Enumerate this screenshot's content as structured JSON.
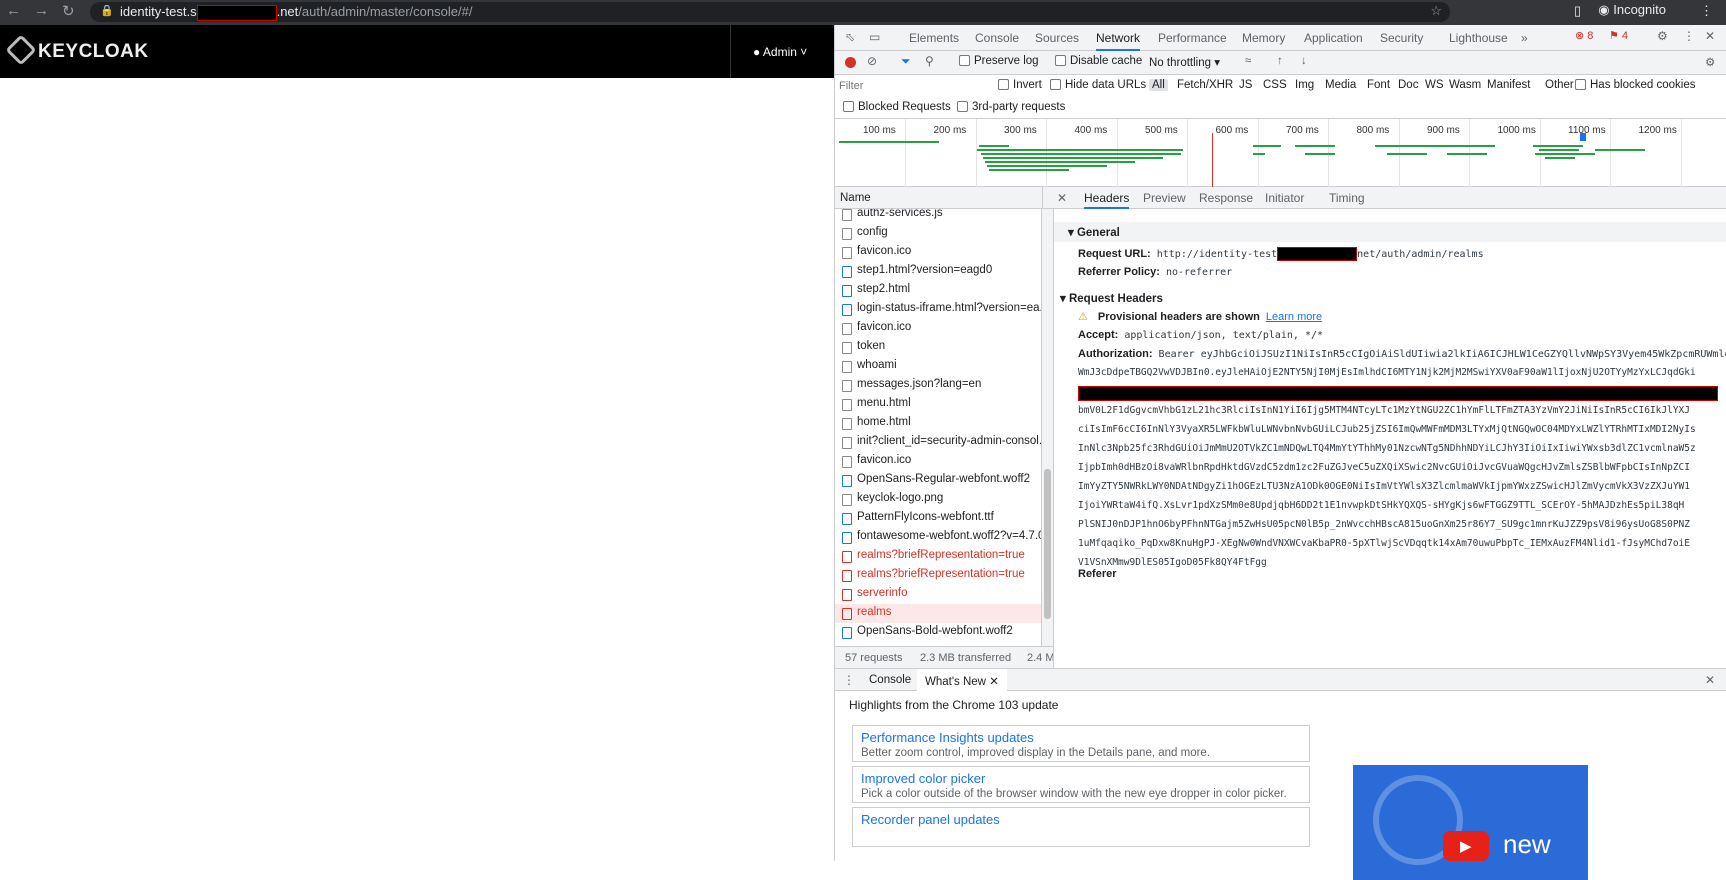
{
  "browser": {
    "url_host_prefix": "identity-test.s",
    "url_host_suffix": ".net",
    "url_path": "/auth/admin/master/console/#/",
    "profile": "Incognito"
  },
  "app": {
    "logo_text": "KEYCLOAK",
    "user_menu": "Admin"
  },
  "devtools": {
    "tabs": [
      "Elements",
      "Console",
      "Sources",
      "Network",
      "Performance",
      "Memory",
      "Application",
      "Security",
      "Lighthouse"
    ],
    "errors": "8",
    "warnings": "4",
    "toolbar": {
      "preserve_log": "Preserve log",
      "disable_cache": "Disable cache",
      "throttling": "No throttling"
    },
    "filter": {
      "placeholder": "Filter",
      "invert": "Invert",
      "hide_data_urls": "Hide data URLs",
      "types": [
        "All",
        "Fetch/XHR",
        "JS",
        "CSS",
        "Img",
        "Media",
        "Font",
        "Doc",
        "WS",
        "Wasm",
        "Manifest",
        "Other"
      ],
      "has_blocked_cookies": "Has blocked cookies",
      "blocked_requests": "Blocked Requests",
      "third_party": "3rd-party requests"
    },
    "timeline_ticks": [
      "100 ms",
      "200 ms",
      "300 ms",
      "400 ms",
      "500 ms",
      "600 ms",
      "700 ms",
      "800 ms",
      "900 ms",
      "1000 ms",
      "1100 ms",
      "1200 ms"
    ],
    "name_header": "Name",
    "requests": [
      {
        "name": "authz-services.js",
        "status": "ok"
      },
      {
        "name": "config",
        "status": "ok"
      },
      {
        "name": "favicon.ico",
        "status": "ok"
      },
      {
        "name": "step1.html?version=eagd0",
        "status": "doc"
      },
      {
        "name": "step2.html",
        "status": "doc"
      },
      {
        "name": "login-status-iframe.html?version=ea...",
        "status": "doc"
      },
      {
        "name": "favicon.ico",
        "status": "ok"
      },
      {
        "name": "token",
        "status": "ok"
      },
      {
        "name": "whoami",
        "status": "ok"
      },
      {
        "name": "messages.json?lang=en",
        "status": "ok"
      },
      {
        "name": "menu.html",
        "status": "ok"
      },
      {
        "name": "home.html",
        "status": "ok"
      },
      {
        "name": "init?client_id=security-admin-consol...",
        "status": "ok"
      },
      {
        "name": "favicon.ico",
        "status": "ok"
      },
      {
        "name": "OpenSans-Regular-webfont.woff2",
        "status": "font"
      },
      {
        "name": "keyclok-logo.png",
        "status": "img"
      },
      {
        "name": "PatternFlyIcons-webfont.ttf",
        "status": "font"
      },
      {
        "name": "fontawesome-webfont.woff2?v=4.7.0",
        "status": "font"
      },
      {
        "name": "realms?briefRepresentation=true",
        "status": "err"
      },
      {
        "name": "realms?briefRepresentation=true",
        "status": "err"
      },
      {
        "name": "serverinfo",
        "status": "err"
      },
      {
        "name": "realms",
        "status": "sel"
      },
      {
        "name": "OpenSans-Bold-webfont.woff2",
        "status": "font"
      }
    ],
    "summary": {
      "requests": "57 requests",
      "transferred": "2.3 MB transferred",
      "resources": "2.4 M"
    },
    "detail_tabs": [
      "Headers",
      "Preview",
      "Response",
      "Initiator",
      "Timing"
    ],
    "general": {
      "title": "General",
      "request_url_label": "Request URL:",
      "request_url_prefix": "http://identity-test",
      "request_url_suffix": "net/auth/admin/realms",
      "referrer_policy_label": "Referrer Policy:",
      "referrer_policy": "no-referrer"
    },
    "request_headers": {
      "title": "Request Headers",
      "provisional": "Provisional headers are shown",
      "learn_more": "Learn more",
      "accept_label": "Accept:",
      "accept": "application/json, text/plain, */*",
      "auth_label": "Authorization:",
      "auth_first": "Bearer eyJhbGciOiJSUzI1NiIsInR5cCIgOiAiSldUIiwia2lkIiA6ICJHLW1CeGZYQllvNWpSY3Vyem45WkZpcmRUWmlo",
      "auth_lines": [
        "WmJ3cDdpeTBGQ2VwVDJBIn0.eyJleHAiOjE2NTY5NjI0MjEsImlhdCI6MTY1Njk2MjM2MSwiYXV0aF90aW1lIjoxNjU2OTYyMzYxLCJqdGki",
        "",
        "bmV0L2F1dGgvcmVhbG1zL21hc3RlciIsInN1YiI6Ijg5MTM4NTcyLTc1MzYtNGU2ZC1hYmFlLTFmZTA3YzVmY2JiNiIsInR5cCI6IkJlYXJ",
        "ciIsImF6cCI6InNlY3VyaXR5LWFkbWluLWNvbnNvbGUiLCJub25jZSI6ImQwMWFmMDM3LTYxMjQtNGQwOC04MDYxLWZlYTRhMTIxMDI2NyIs",
        "InNlc3Npb25fc3RhdGUiOiJmMmU2OTVkZC1mNDQwLTQ4MmYtYThhMy01NzcwNTg5NDhhNDYiLCJhY3IiOiIxIiwiYWxsb3dlZC1vcmlnaW5z",
        "IjpbImh0dHBzOi8vaWRlbnRpdHktdGVzdC5zdm1zc2FuZGJveC5uZXQiXSwic2NvcGUiOiJvcGVuaWQgcHJvZmlsZSBlbWFpbCIsInNpZCI",
        "ImYyZTY5NWRkLWY0NDAtNDgyZi1hOGEzLTU3NzA1ODk0OGE0NiIsImVtYWlsX3ZlcmlmaWVkIjpmYWxzZSwicHJlZmVycmVkX3VzZXJuYW1",
        "IjoiYWRtaW4ifQ.XsLvr1pdXzSMm0e8UpdjqbH6DD2t1E1nvwpkDtSHkYQXQS-sHYgKjs6wFTGGZ9TTL_SCErOY-5hMAJDzhEs5piL38qH",
        "PlSNIJ0nDJP1hnO6byPFhnNTGajm5ZwHsU05pcN0lB5p_2nWvcchHBscA815uoGnXm25r86Y7_SU9gc1mnrKuJZZ9psV8i96ysUoG8S0PNZ",
        "1uMfqaqiko_PqDxw8KnuHgPJ-XEgNw0WndVNXWCvaKbaPR0-5pXTlwjScVDqqtk14xAm70uwuPbpTc_IEMxAuzFM4Nlid1-fJsyMChd7oiE",
        "V1VSnXMmw9DlES05IgoD05Fk8QY4FtFgg"
      ],
      "referer_label": "Referer"
    },
    "drawer": {
      "tabs": [
        "Console",
        "What's New"
      ],
      "highlights": "Highlights from the Chrome 103 update",
      "cards": [
        {
          "title": "Performance Insights updates",
          "desc": "Better zoom control, improved display in the Details pane, and more."
        },
        {
          "title": "Improved color picker",
          "desc": "Pick a color outside of the browser window with the new eye dropper in color picker."
        },
        {
          "title": "Recorder panel updates",
          "desc": ""
        }
      ],
      "promo_text": "new"
    }
  },
  "colors": {
    "accent": "#1a73e8",
    "error": "#d93025",
    "waterfall": "#26a043"
  }
}
